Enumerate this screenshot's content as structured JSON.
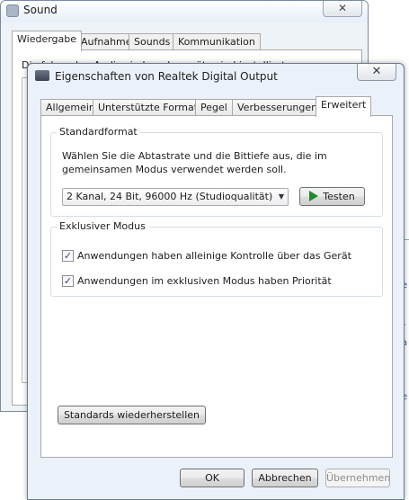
{
  "background_window": {
    "title": "Sound",
    "close_label": "✕",
    "tabs": [
      {
        "label": "Wiedergabe"
      },
      {
        "label": "Aufnahme"
      },
      {
        "label": "Sounds"
      },
      {
        "label": "Kommunikation"
      }
    ],
    "partial_text": "Die folgenden Audiowiedergabegeräte sind installiert:",
    "right_peek": [
      "e",
      "r",
      "a",
      "e"
    ]
  },
  "dialog": {
    "title": "Eigenschaften von Realtek Digital Output",
    "close_label": "✕",
    "tabs": [
      {
        "label": "Allgemein"
      },
      {
        "label": "Unterstützte Formate"
      },
      {
        "label": "Pegel"
      },
      {
        "label": "Verbesserungen"
      },
      {
        "label": "Erweitert"
      }
    ],
    "active_tab": "Erweitert",
    "standard_format": {
      "title": "Standardformat",
      "description": "Wählen Sie die Abtastrate und die Bittiefe aus, die im gemeinsamen Modus verwendet werden soll.",
      "selected_format": "2 Kanal, 24 Bit, 96000 Hz (Studioqualität)",
      "test_button": "Testen"
    },
    "exclusive_mode": {
      "title": "Exklusiver Modus",
      "options": [
        {
          "label": "Anwendungen haben alleinige Kontrolle über das Gerät",
          "checked": true
        },
        {
          "label": "Anwendungen im exklusiven Modus haben Priorität",
          "checked": true
        }
      ]
    },
    "restore_defaults_button": "Standards wiederherstellen",
    "footer": {
      "ok": "OK",
      "cancel": "Abbrechen",
      "apply": "Übernehmen"
    }
  },
  "colors": {
    "test_icon": "#1f8a2c",
    "dialog_frame": "#eaf1f9"
  }
}
